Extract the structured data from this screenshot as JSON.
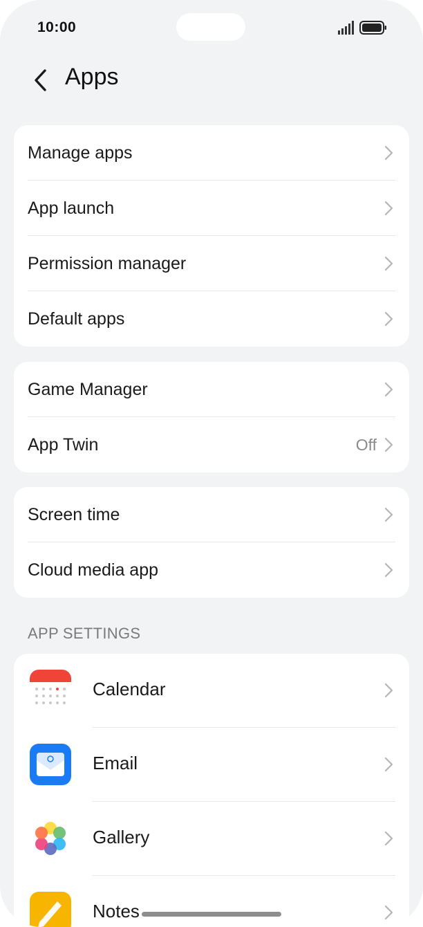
{
  "status_bar": {
    "time": "10:00"
  },
  "header": {
    "title": "Apps"
  },
  "group1": [
    {
      "label": "Manage apps"
    },
    {
      "label": "App launch"
    },
    {
      "label": "Permission manager"
    },
    {
      "label": "Default apps"
    }
  ],
  "group2": [
    {
      "label": "Game Manager"
    },
    {
      "label": "App Twin",
      "value": "Off"
    }
  ],
  "group3": [
    {
      "label": "Screen time"
    },
    {
      "label": "Cloud media app"
    }
  ],
  "app_settings": {
    "header": "APP SETTINGS",
    "items": [
      {
        "label": "Calendar",
        "icon": "calendar-icon"
      },
      {
        "label": "Email",
        "icon": "email-icon"
      },
      {
        "label": "Gallery",
        "icon": "gallery-icon"
      },
      {
        "label": "Notes",
        "icon": "notes-icon"
      }
    ]
  },
  "colors": {
    "background": "#f1f3f5",
    "card": "#ffffff",
    "calendar_red": "#f04438",
    "email_blue": "#1a7cf5",
    "notes_yellow": "#f7b500"
  }
}
